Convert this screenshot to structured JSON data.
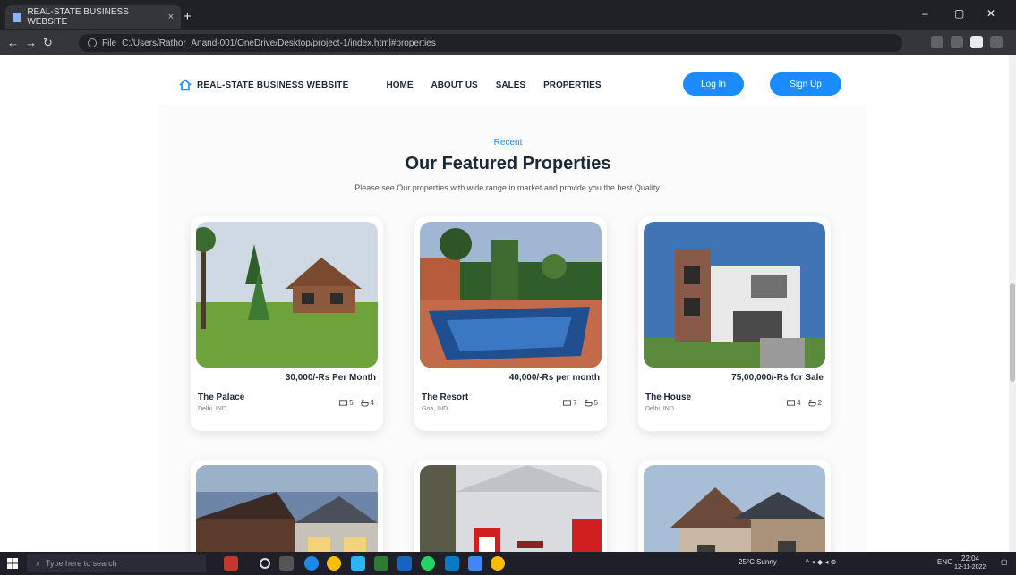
{
  "browser": {
    "tab_title": "REAL-STATE BUSINESS WEBSITE",
    "tab_close": "×",
    "new_tab": "+",
    "url_prefix": "File",
    "url": "C:/Users/Rathor_Anand-001/OneDrive/Desktop/project-1/index.html#properties",
    "min": "–",
    "max": "▢",
    "close": "✕"
  },
  "site": {
    "logo_text": "REAL-STATE BUSINESS WEBSITE",
    "nav": [
      "HOME",
      "ABOUT US",
      "SALES",
      "PROPERTIES"
    ],
    "login": "Log In",
    "signup": "Sign Up"
  },
  "section": {
    "tag": "Recent",
    "title": "Our Featured Properties",
    "subtitle": "Please see Our properties with wide range in market and provide you the best Quality."
  },
  "properties": [
    {
      "price": "30,000/-Rs Per Month",
      "name": "The Palace",
      "location": "Delhi, IND",
      "beds": "5",
      "baths": "4"
    },
    {
      "price": "40,000/-Rs per month",
      "name": "The Resort",
      "location": "Goa, IND",
      "beds": "7",
      "baths": "5"
    },
    {
      "price": "75,00,000/-Rs for Sale",
      "name": "The House",
      "location": "Delhi, IND",
      "beds": "4",
      "baths": "2"
    }
  ],
  "taskbar": {
    "search_placeholder": "Type here to search",
    "weather": "25°C Sunny",
    "lang": "ENG",
    "time": "22:04",
    "date": "12-11-2022"
  },
  "colors": {
    "accent": "#1a8cff",
    "dark_text": "#1b2838"
  }
}
